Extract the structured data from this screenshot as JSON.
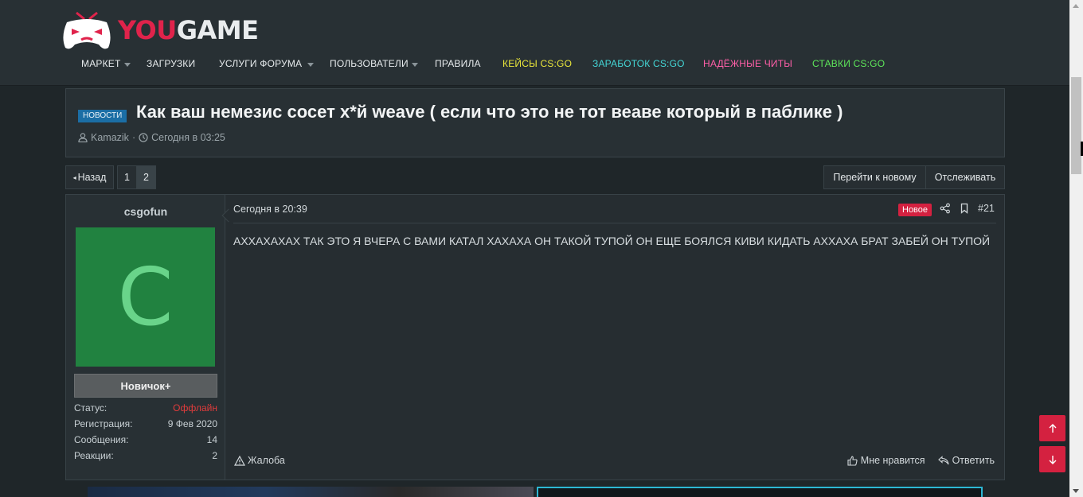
{
  "site": {
    "logo_you": "YOU",
    "logo_game": "GAME"
  },
  "nav": [
    {
      "label": "МАРКЕТ",
      "color": "#e7ebed",
      "caret": true
    },
    {
      "label": "ЗАГРУЗКИ",
      "color": "#e7ebed",
      "caret": false
    },
    {
      "label": "УСЛУГИ ФОРУМА",
      "color": "#e7ebed",
      "caret": true
    },
    {
      "label": "ПОЛЬЗОВАТЕЛИ",
      "color": "#e7ebed",
      "caret": true
    },
    {
      "label": "ПРАВИЛА",
      "color": "#e7ebed",
      "caret": false
    },
    {
      "label": "КЕЙСЫ CS:GO",
      "color": "#e9e53a",
      "caret": false
    },
    {
      "label": "ЗАРАБОТОК CS:GO",
      "color": "#44d6d6",
      "caret": false
    },
    {
      "label": "НАДЁЖНЫЕ ЧИТЫ",
      "color": "#ff5fa8",
      "caret": false
    },
    {
      "label": "СТАВКИ CS:GO",
      "color": "#5ee65a",
      "caret": false
    }
  ],
  "thread": {
    "prefix": "НОВОСТИ",
    "title": "Как ваш немезис сосет х*й weave ( если что это не тот веаве который в паблике )",
    "author": "Kamazik",
    "separator": "·",
    "date": "Сегодня в 03:25"
  },
  "pagination": {
    "back_label": "Назад",
    "pages": [
      "1",
      "2"
    ],
    "current": "2",
    "goto_new_label": "Перейти к новому",
    "watch_label": "Отслеживать"
  },
  "post": {
    "username": "csgofun",
    "avatar_letter": "C",
    "rank": "Новичок+",
    "stats": [
      {
        "label": "Статус:",
        "value": "Оффлайн"
      },
      {
        "label": "Регистрация:",
        "value": "9 Фев 2020"
      },
      {
        "label": "Сообщения:",
        "value": "14"
      },
      {
        "label": "Реакции:",
        "value": "2"
      }
    ],
    "date": "Сегодня в 20:39",
    "new_tag": "Новое",
    "number": "#21",
    "text": "АХХАХАХАХ ТАК ЭТО Я ВЧЕРА С ВАМИ КАТАЛ ХАХАХА ОН ТАКОЙ ТУПОЙ ОН ЕЩЕ БОЯЛСЯ КИВИ КИДАТЬ АХХАХА БРАТ ЗАБЕЙ ОН ТУПОЙ",
    "report_label": "Жалоба",
    "like_label": "Мне нравится",
    "reply_label": "Ответить"
  },
  "colors": {
    "accent": "#d42140",
    "prefix_blue": "#1b6ea5",
    "avatar_bg": "#218240",
    "avatar_fg": "#69d48a"
  }
}
